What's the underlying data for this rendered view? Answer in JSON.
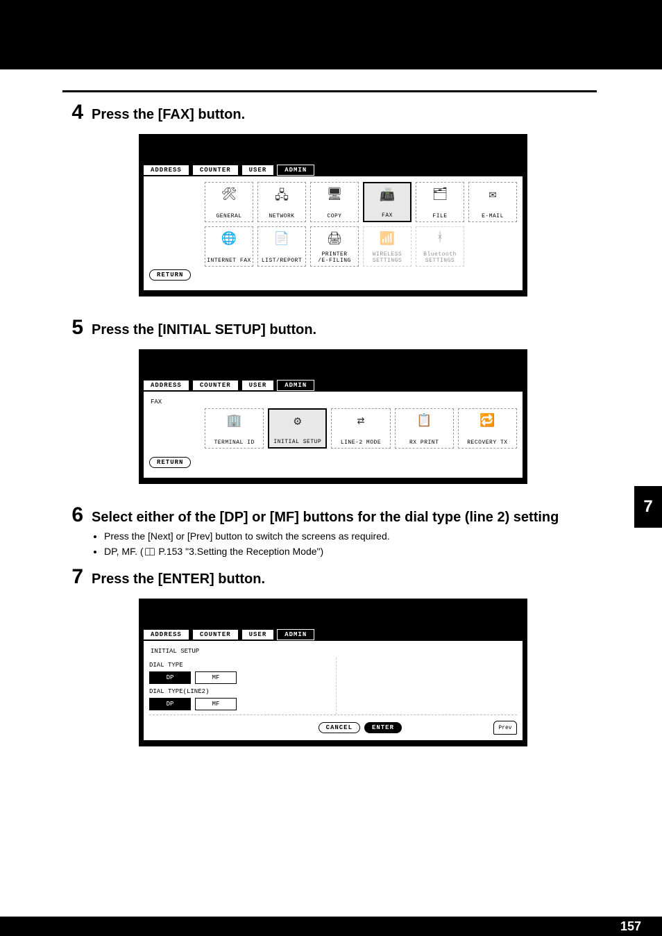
{
  "page_number": "157",
  "chapter_tab": "7",
  "steps": {
    "s4": {
      "num": "4",
      "title": "Press the [FAX] button."
    },
    "s5": {
      "num": "5",
      "title": "Press the [INITIAL SETUP] button."
    },
    "s6": {
      "num": "6",
      "title": "Select either of the [DP] or [MF] buttons for the dial type (line 2) setting",
      "bullet1": "Press the [Next] or [Prev] button to switch the screens as required.",
      "bullet2_prefix": "DP, MF. (",
      "bullet2_ref": "P.153 \"3.Setting the Reception Mode\"",
      "bullet2_suffix": ")"
    },
    "s7": {
      "num": "7",
      "title": "Press the [ENTER] button."
    }
  },
  "ui": {
    "tabs": {
      "address": "ADDRESS",
      "counter": "COUNTER",
      "user": "USER",
      "admin": "ADMIN"
    },
    "return": "RETURN",
    "admin_grid": {
      "general": "GENERAL",
      "network": "NETWORK",
      "copy": "COPY",
      "fax": "FAX",
      "file": "FILE",
      "email": "E-MAIL",
      "internet_fax": "INTERNET FAX",
      "list_report": "LIST/REPORT",
      "printer_efiling": "PRINTER\n/E-FILING",
      "wireless": "WIRELESS\nSETTINGS",
      "bluetooth": "Bluetooth\nSETTINGS"
    },
    "fax_context": "FAX",
    "fax_grid": {
      "terminal_id": "TERMINAL ID",
      "initial_setup": "INITIAL SETUP",
      "line2_mode": "LINE-2 MODE",
      "rx_print": "RX PRINT",
      "recovery_tx": "RECOVERY TX"
    },
    "initial": {
      "context": "INITIAL SETUP",
      "dial_type": "DIAL TYPE",
      "dial_type_line2": "DIAL TYPE(LINE2)",
      "dp": "DP",
      "mf": "MF",
      "cancel": "CANCEL",
      "enter": "ENTER",
      "prev": "Prev"
    }
  }
}
